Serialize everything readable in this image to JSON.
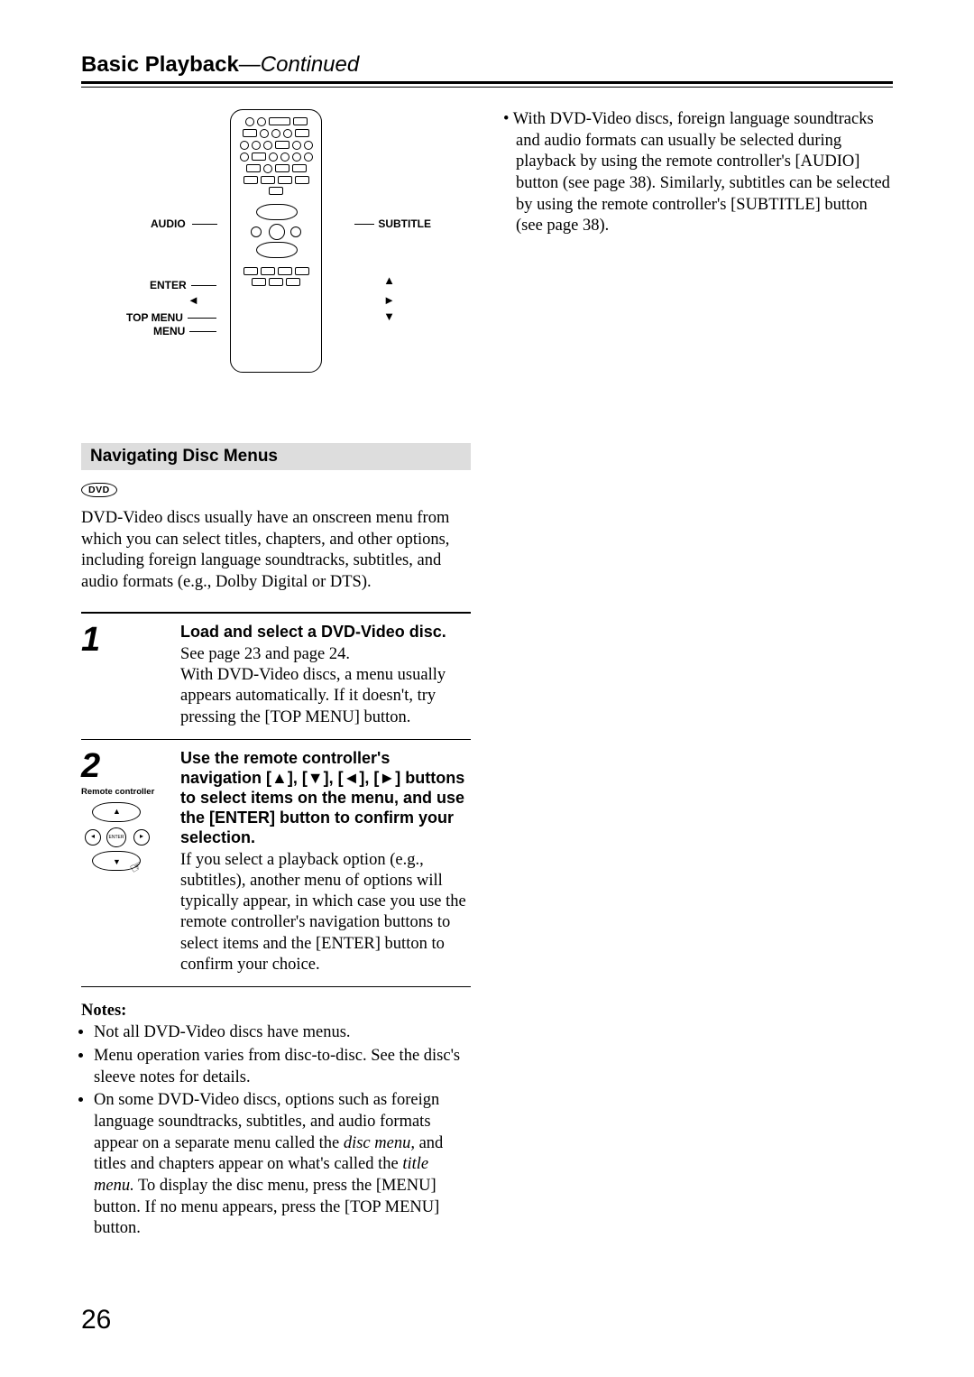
{
  "header": {
    "title": "Basic Playback",
    "continued": "—Continued"
  },
  "remote_labels": {
    "audio": "AUDIO",
    "subtitle": "SUBTITLE",
    "enter": "ENTER",
    "top_menu": "TOP MENU",
    "menu": "MENU",
    "arrow_left": "◄",
    "arrow_right": "►",
    "arrow_up": "▲",
    "arrow_down": "▼"
  },
  "right_column": {
    "bullet": "• With DVD-Video discs, foreign language soundtracks and audio formats can usually be selected during playback by using the remote controller's [AUDIO] button (see page 38). Similarly, subtitles can be selected by using the remote controller's [SUBTITLE] button (see page 38)."
  },
  "section": {
    "heading": "Navigating Disc Menus",
    "dvd_badge": "DVD",
    "intro": "DVD-Video discs usually have an onscreen menu from which you can select titles, chapters, and other options, including foreign language soundtracks, subtitles, and audio formats (e.g., Dolby Digital or DTS)."
  },
  "steps": [
    {
      "num": "1",
      "heading": "Load and select a DVD-Video disc.",
      "body": "See page 23 and page 24.\nWith DVD-Video discs, a menu usually appears automatically. If it doesn't, try pressing the [TOP MENU] button."
    },
    {
      "num": "2",
      "sublabel": "Remote controller",
      "heading": "Use the remote controller's navigation [▲], [▼], [◄], [►] buttons to select items on the menu, and use the [ENTER] button to confirm your selection.",
      "body": "If you select a playback option (e.g., subtitles), another menu of options will typically appear, in which case you use the remote controller's navigation buttons to select items and the [ENTER] button to confirm your choice."
    }
  ],
  "notes": {
    "heading": "Notes:",
    "items": [
      "Not all DVD-Video discs have menus.",
      "Menu operation varies from disc-to-disc. See the disc's sleeve notes for details.",
      "On some DVD-Video discs, options such as foreign language soundtracks, subtitles, and audio formats appear on a separate menu called the <i>disc menu,</i> and titles and chapters appear on what's called the <i>title menu.</i> To display the disc menu, press the [MENU] button. If no menu appears, press the [TOP MENU] button."
    ]
  },
  "page_number": "26"
}
